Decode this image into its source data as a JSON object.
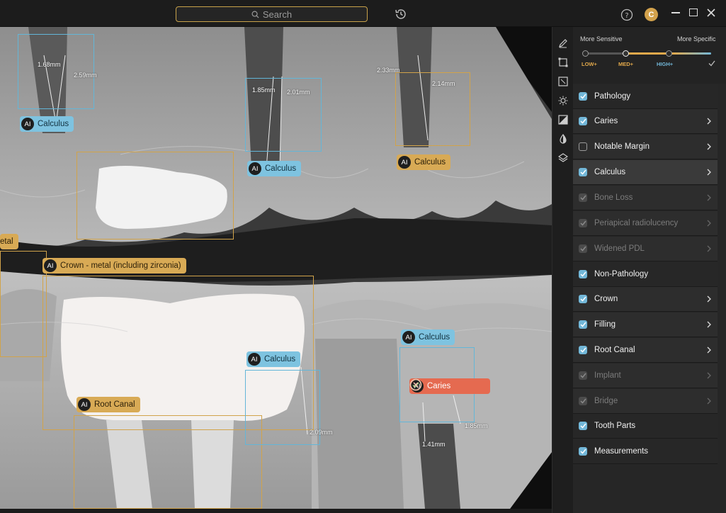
{
  "titlebar": {
    "search_placeholder": "Search",
    "avatar_initial": "C"
  },
  "annotations": {
    "labels": {
      "calculus_1": "Calculus",
      "calculus_2": "Calculus",
      "calculus_3": "Calculus",
      "calculus_4": "Calculus",
      "calculus_5": "Calculus",
      "crown": "Crown - metal (including zirconia)",
      "crown_partial": "etal",
      "root_canal": "Root Canal",
      "caries": "Caries",
      "ai_badge": "AI"
    },
    "measurements": {
      "m1": "1.68mm",
      "m2": "2.59mm",
      "m3": "1.85mm",
      "m4": "2.01mm",
      "m5": "2.33mm",
      "m6": "2.14mm",
      "m7": "2.09mm",
      "m8": "1.85mm",
      "m9": "1.41mm"
    }
  },
  "sensitivity": {
    "more_sensitive": "More Sensitive",
    "more_specific": "More Specific",
    "levels": [
      "LOW+",
      "MED+",
      "HIGH+"
    ],
    "selected_level": "MED+",
    "low_color": "#e2a94b",
    "high_color": "#72b7d8"
  },
  "filters": {
    "pathology": "Pathology",
    "caries": "Caries",
    "notable_margin": "Notable Margin",
    "calculus": "Calculus",
    "bone_loss": "Bone Loss",
    "periapical": "Periapical radiolucency",
    "widened_pdl": "Widened PDL",
    "non_pathology": "Non-Pathology",
    "crown": "Crown",
    "filling": "Filling",
    "root_canal": "Root Canal",
    "implant": "Implant",
    "bridge": "Bridge",
    "tooth_parts": "Tooth Parts",
    "measurements": "Measurements"
  },
  "colors": {
    "calculus_blue": "#63b6d8",
    "crown_gold": "#d1a34a",
    "caries_red": "#e56a50"
  }
}
